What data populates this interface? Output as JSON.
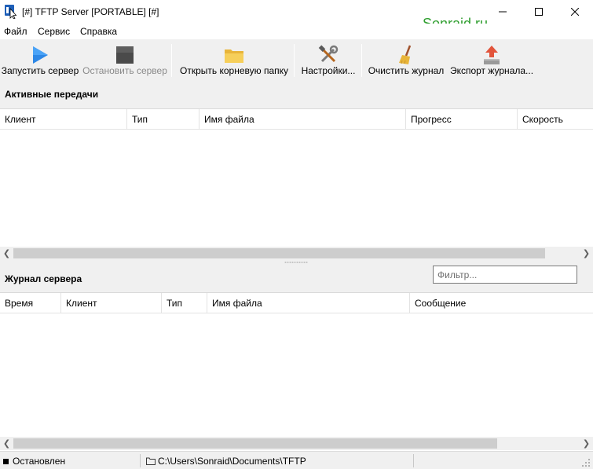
{
  "window": {
    "title": "[#] TFTP Server [PORTABLE] [#]",
    "watermark": "Sonraid.ru",
    "watermark_color": "#2e9e2e",
    "controls": [
      "minimize-icon",
      "maximize-icon",
      "close-icon"
    ]
  },
  "menu": {
    "items": [
      "Файл",
      "Сервис",
      "Справка"
    ]
  },
  "toolbar": {
    "buttons": [
      {
        "label": "Запустить сервер",
        "icon": "play-icon",
        "enabled": true
      },
      {
        "label": "Остановить сервер",
        "icon": "stop-icon",
        "enabled": false
      },
      {
        "label": "Открыть корневую папку",
        "icon": "folder-icon",
        "enabled": true
      },
      {
        "label": "Настройки...",
        "icon": "tools-icon",
        "enabled": true
      },
      {
        "label": "Очистить журнал",
        "icon": "broom-icon",
        "enabled": true
      },
      {
        "label": "Экспорт журнала...",
        "icon": "export-icon",
        "enabled": true
      }
    ]
  },
  "active_transfers": {
    "title": "Активные передачи",
    "columns": [
      "Клиент",
      "Тип",
      "Имя файла",
      "Прогресс",
      "Скорость"
    ],
    "rows": []
  },
  "server_log": {
    "title": "Журнал сервера",
    "filter_placeholder": "Фильтр...",
    "filter_value": "",
    "columns": [
      "Время",
      "Клиент",
      "Тип",
      "Имя файла",
      "Сообщение"
    ],
    "rows": []
  },
  "status": {
    "state": "Остановлен",
    "path": "C:\\Users\\Sonraid\\Documents\\TFTP"
  }
}
